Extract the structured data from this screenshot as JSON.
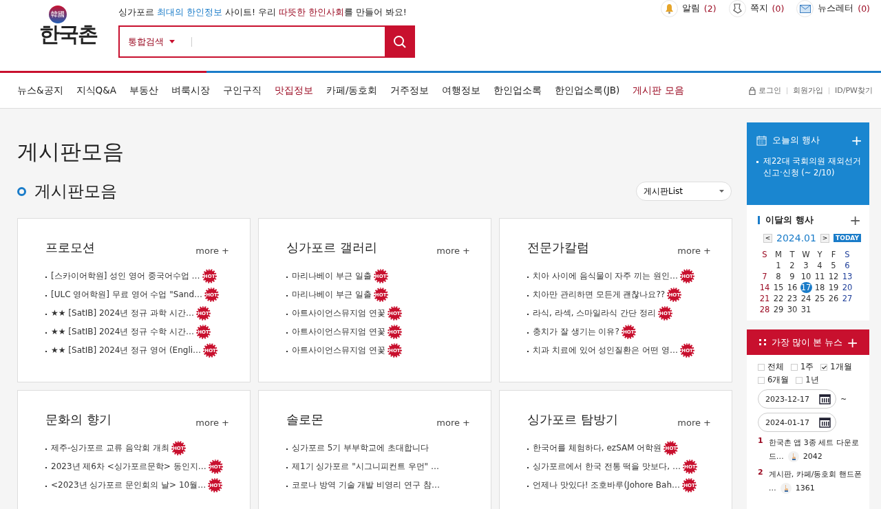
{
  "logo": {
    "seal": "韓國",
    "text": "한국촌"
  },
  "tagline": [
    {
      "text": "싱가포르 ",
      "kind": "plain"
    },
    {
      "text": "최대의 한인정보",
      "kind": "info"
    },
    {
      "text": " 사이트! 우리 ",
      "kind": "plain"
    },
    {
      "text": "따뜻한 한인사회",
      "kind": "warm"
    },
    {
      "text": "를 만들어 봐요!",
      "kind": "plain"
    }
  ],
  "search": {
    "scope": "통합검색"
  },
  "top_links": [
    {
      "kind": "bell",
      "label": "알림",
      "count": "(2)"
    },
    {
      "kind": "note",
      "label": "쪽지",
      "count": "(0)"
    },
    {
      "kind": "mail",
      "label": "뉴스레터",
      "count": "(0)"
    }
  ],
  "nav": [
    {
      "label": "뉴스&공지",
      "highlighted": false
    },
    {
      "label": "지식Q&A",
      "highlighted": false
    },
    {
      "label": "부동산",
      "highlighted": false
    },
    {
      "label": "벼룩시장",
      "highlighted": false
    },
    {
      "label": "구인구직",
      "highlighted": false
    },
    {
      "label": "맛집정보",
      "highlighted": true
    },
    {
      "label": "카페/동호회",
      "highlighted": false
    },
    {
      "label": "거주정보",
      "highlighted": false
    },
    {
      "label": "여행정보",
      "highlighted": false
    },
    {
      "label": "한인업소록",
      "highlighted": false
    },
    {
      "label": "한인업소록(JB)",
      "highlighted": false
    },
    {
      "label": "게시판 모음",
      "highlighted": true
    }
  ],
  "account_links": [
    {
      "kind": "lock",
      "label": "로그인"
    },
    {
      "kind": "plain",
      "label": "회원가입"
    },
    {
      "kind": "plain",
      "label": "ID/PW찾기"
    }
  ],
  "page_title": "게시판모음",
  "section_title": "게시판모음",
  "board_select": "게시판List",
  "boards": [
    {
      "title": "프로모션",
      "more": "more +",
      "items": [
        {
          "text": "[스카이어학원] 성인 영어 중국어수업 …",
          "badge": "HOT"
        },
        {
          "text": "[ULC 영어학원] 무료 영어 수업 \"Sand…",
          "badge": "HOT"
        },
        {
          "text": "★★ [SatIB] 2024년 정규 과학 시간…",
          "badge": "HOT"
        },
        {
          "text": "★★ [SatIB] 2024년 정규 수학 시간…",
          "badge": "HOT"
        },
        {
          "text": "★★ [SatIB] 2024년 정규 영어 (Engli…",
          "badge": "HOT"
        }
      ]
    },
    {
      "title": "싱가포르 갤러리",
      "more": "more +",
      "items": [
        {
          "text": "마리나베이 부근 일출",
          "badge": "HOT"
        },
        {
          "text": "마리나베이 부근 일출",
          "badge": "HOT"
        },
        {
          "text": "아트사이언스뮤지엄 연꽃",
          "badge": "HOT"
        },
        {
          "text": "아트사이언스뮤지엄 연꽃",
          "badge": "HOT"
        },
        {
          "text": "아트사이언스뮤지엄 연꽃",
          "badge": "HOT"
        }
      ]
    },
    {
      "title": "전문가칼럼",
      "more": "more +",
      "items": [
        {
          "text": "치아 사이에 음식물이 자주 끼는 원인…",
          "badge": "HOT"
        },
        {
          "text": "치아만 관리하면 모든게 괜찮나요??",
          "badge": "HOT"
        },
        {
          "text": "라식, 라섹, 스마일라식 간단 정리",
          "badge": "HOT"
        },
        {
          "text": "충치가 잘 생기는 이유?",
          "badge": "HOT"
        },
        {
          "text": "치과 치료에 있어 성인질환은 어떤 영…",
          "badge": "HOT"
        }
      ]
    },
    {
      "title": "문화의 향기",
      "more": "more +",
      "items": [
        {
          "text": "제주-싱가포르 교류 음악회 개최",
          "badge": "HOT"
        },
        {
          "text": "2023년 제6차 <싱가포르문학> 동인지…",
          "badge": "HOT"
        },
        {
          "text": "<2023년 싱가포르 문인회의 날> 10월…",
          "badge": "HOT"
        }
      ]
    },
    {
      "title": "솔로몬",
      "more": "more +",
      "items": [
        {
          "text": "싱가포르 5기 부부학교에 초대합니다"
        },
        {
          "text": "제1기 싱가포르 \"시그니피컨트 우먼\" …"
        },
        {
          "text": "코로나 방역 기술 개발 비영리 연구 참…"
        }
      ]
    },
    {
      "title": "싱가포르 탐방기",
      "more": "more +",
      "items": [
        {
          "text": "한국어를 체험하다, ezSAM 어학원",
          "badge": "HOT"
        },
        {
          "text": "싱가포르에서 한국 전통 떡을 맛보다, …",
          "badge": "HOT"
        },
        {
          "text": "언제나 맛있다! 조호바루(Johore Bah…",
          "badge": "HOT"
        }
      ]
    }
  ],
  "today_events": {
    "title": "오늘의 행사",
    "add": "+",
    "items": [
      "제22대 국회의원 재외선거 신고·신청 (~ 2/10)"
    ]
  },
  "month_events": {
    "title": "이달의 행사",
    "add": "+",
    "prev": "<",
    "month": "2024.01",
    "next": ">",
    "today": "TODAY",
    "weekdays": [
      "S",
      "M",
      "T",
      "W",
      "Y",
      "F",
      "S"
    ],
    "weeks": [
      {
        "kind": "partial",
        "days": [
          {
            "day": "1",
            "selected": false
          },
          {
            "day": "2",
            "selected": false
          },
          {
            "day": "3",
            "selected": false
          },
          {
            "day": "4",
            "selected": false
          },
          {
            "day": "5",
            "selected": false
          },
          {
            "day": "6",
            "selected": false
          }
        ]
      },
      {
        "kind": "full",
        "days": [
          {
            "day": "7",
            "selected": false
          },
          {
            "day": "8",
            "selected": false
          },
          {
            "day": "9",
            "selected": false
          },
          {
            "day": "10",
            "selected": false
          },
          {
            "day": "11",
            "selected": false
          },
          {
            "day": "12",
            "selected": false
          },
          {
            "day": "13",
            "selected": false
          }
        ]
      },
      {
        "kind": "full",
        "days": [
          {
            "day": "14",
            "selected": false
          },
          {
            "day": "15",
            "selected": false
          },
          {
            "day": "16",
            "selected": false
          },
          {
            "day": "17",
            "selected": true
          },
          {
            "day": "18",
            "selected": false
          },
          {
            "day": "19",
            "selected": false
          },
          {
            "day": "20",
            "selected": false
          }
        ]
      },
      {
        "kind": "full",
        "days": [
          {
            "day": "21",
            "selected": false
          },
          {
            "day": "22",
            "selected": false
          },
          {
            "day": "23",
            "selected": false
          },
          {
            "day": "24",
            "selected": false
          },
          {
            "day": "25",
            "selected": false
          },
          {
            "day": "26",
            "selected": false
          },
          {
            "day": "27",
            "selected": false
          }
        ]
      },
      {
        "kind": "full",
        "days": [
          {
            "day": "28",
            "selected": false
          },
          {
            "day": "29",
            "selected": false
          },
          {
            "day": "30",
            "selected": false
          },
          {
            "day": "31",
            "selected": false
          }
        ]
      }
    ]
  },
  "most_viewed": {
    "title": "가장 많이 본 뉴스",
    "add": "+",
    "periods": [
      {
        "label": "전체",
        "checked": false
      },
      {
        "label": "1주",
        "checked": false
      },
      {
        "label": "1개월",
        "checked": true
      },
      {
        "label": "6개월",
        "checked": false
      },
      {
        "label": "1년",
        "checked": false
      }
    ],
    "date_from": "2023-12-17",
    "range_sep": "~",
    "date_to": "2024-01-17",
    "items": [
      {
        "rank": "1",
        "title": "한국촌 앱 3종 세트 다운로드…",
        "views": "2042"
      },
      {
        "rank": "2",
        "title": "게시판, 카페/동호회 핸드폰 …",
        "views": "1361"
      }
    ]
  }
}
